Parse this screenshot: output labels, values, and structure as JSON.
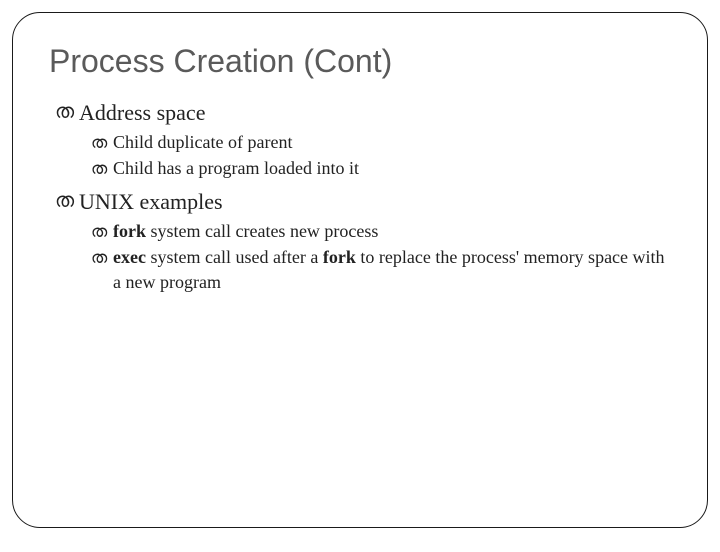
{
  "title": "Process Creation (Cont)",
  "bulletGlyph": "ത",
  "items": [
    {
      "text": "Address space",
      "children": [
        {
          "text": "Child duplicate of parent"
        },
        {
          "text": "Child has a program loaded into it"
        }
      ]
    },
    {
      "text": "UNIX examples",
      "children": [
        {
          "spans": [
            {
              "text": "fork",
              "bold": true
            },
            {
              "text": " system call creates new process"
            }
          ]
        },
        {
          "spans": [
            {
              "text": "exec",
              "bold": true
            },
            {
              "text": " system call used after a "
            },
            {
              "text": "fork",
              "bold": true
            },
            {
              "text": " to replace the process' memory space with a new program"
            }
          ]
        }
      ]
    }
  ]
}
